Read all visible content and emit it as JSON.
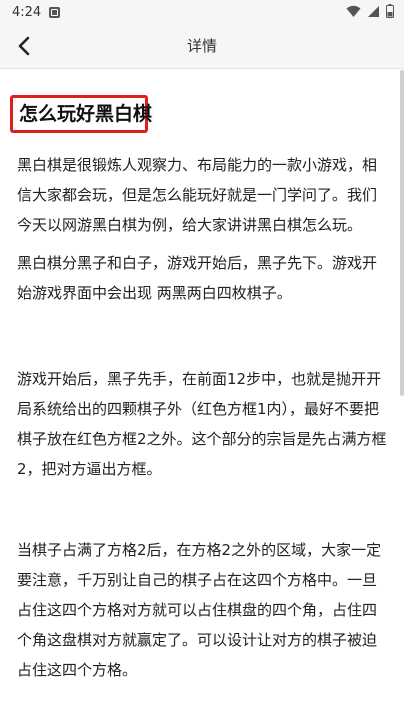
{
  "status_bar": {
    "time": "4:24",
    "notification_icon": "image-icon",
    "wifi_icon": "wifi-icon",
    "signal_icon": "signal-icon",
    "battery_icon": "battery-icon"
  },
  "header": {
    "back_icon": "chevron-left-icon",
    "title": "详情"
  },
  "article": {
    "title": "怎么玩好黑白棋",
    "title_border_color": "#e01e1e",
    "paragraphs": [
      "黑白棋是很锻炼人观察力、布局能力的一款小游戏，相信大家都会玩，但是怎么能玩好就是一门学问了。我们今天以网游黑白棋为例，给大家讲讲黑白棋怎么玩。",
      "黑白棋分黑子和白子，游戏开始后，黑子先下。游戏开始游戏界面中会出现 两黑两白四枚棋子。",
      "游戏开始后，黑子先手，在前面12步中，也就是抛开开局系统给出的四颗棋子外（红色方框1内），最好不要把棋子放在红色方框2之外。这个部分的宗旨是先占满方框2，把对方逼出方框。",
      "当棋子占满了方格2后，在方格2之外的区域，大家一定要注意，千万别让自己的棋子占在这四个方格中。一旦占住这四个方格对方就可以占住棋盘的四个角，占住四个角这盘棋对方就赢定了。可以设计让对方的棋子被迫占住这四个方格。"
    ]
  }
}
